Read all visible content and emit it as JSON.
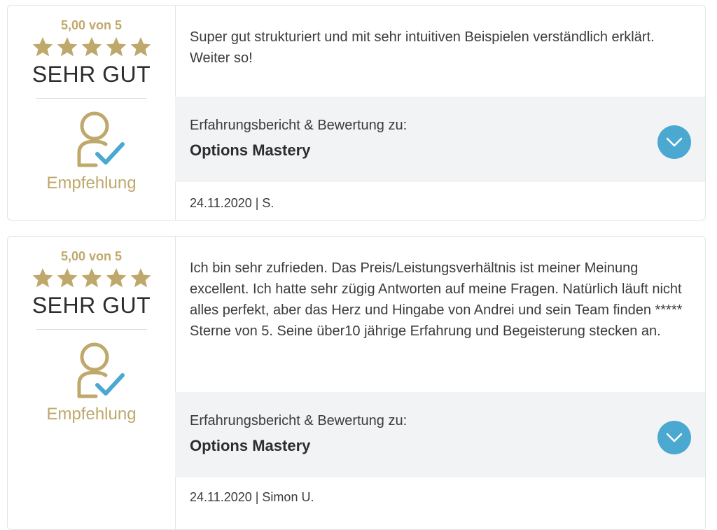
{
  "colors": {
    "gold": "#bfa86b",
    "accent": "#4aa8d1",
    "panel": "#f2f3f5"
  },
  "reviews": [
    {
      "score": "5,00 von 5",
      "stars": 5,
      "rating_label": "SEHR GUT",
      "recommendation_icon": "person-check-icon",
      "recommendation": "Empfehlung",
      "text": "Super gut strukturiert und mit sehr intuitiven Beispielen verständlich erklärt. Weiter so!",
      "ref_label": "Erfahrungsbericht & Bewertung zu:",
      "product": "Options Mastery",
      "expand_icon": "chevron-down-icon",
      "footer": "24.11.2020 | S."
    },
    {
      "score": "5,00 von 5",
      "stars": 5,
      "rating_label": "SEHR GUT",
      "recommendation_icon": "person-check-icon",
      "recommendation": "Empfehlung",
      "text": "Ich bin sehr zufrieden. Das Preis/Leistungsverhältnis ist meiner Meinung excellent. Ich hatte sehr zügig Antworten auf meine Fragen. Natürlich läuft nicht alles perfekt, aber das Herz und Hingabe von Andrei und sein Team finden ***** Sterne von 5. Seine über10 jährige Erfahrung und Begeisterung stecken an.",
      "ref_label": "Erfahrungsbericht & Bewertung zu:",
      "product": "Options Mastery",
      "expand_icon": "chevron-down-icon",
      "footer": "24.11.2020 | Simon U."
    }
  ]
}
